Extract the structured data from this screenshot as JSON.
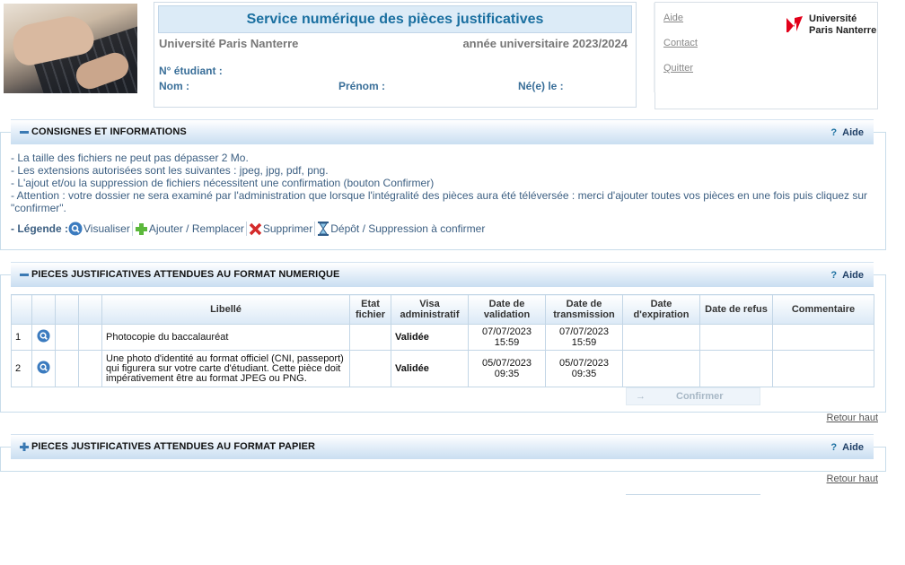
{
  "header": {
    "title": "Service numérique des pièces justificatives",
    "university": "Université Paris Nanterre",
    "year": "année universitaire 2023/2024",
    "student_number_label": "N° étudiant :",
    "last_name_label": "Nom :",
    "first_name_label": "Prénom :",
    "birth_label": "Né(e) le :"
  },
  "links": {
    "aide": "Aide",
    "contact": "Contact",
    "quitter": "Quitter"
  },
  "logo": {
    "line1": "Université",
    "line2": "Paris Nanterre",
    "color": "#e2001a"
  },
  "sections": {
    "consignes": {
      "title": "CONSIGNES ET INFORMATIONS",
      "help": "Aide",
      "lines": [
        "- La taille des fichiers ne peut pas dépasser 2 Mo.",
        "- Les extensions autorisées sont les suivantes : jpeg, jpg, pdf, png.",
        "- L'ajout et/ou la suppression de fichiers nécessitent une confirmation (bouton Confirmer)",
        "- Attention : votre dossier ne sera examiné par l'administration que lorsque l'intégralité des pièces aura été téléversée : merci d'ajouter toutes vos pièces en une fois puis cliquez sur \"confirmer\"."
      ],
      "legend": {
        "label": "- Légende :",
        "view": "Visualiser",
        "add": "Ajouter / Remplacer",
        "delete": "Supprimer",
        "pending": "Dépôt / Suppression à confirmer"
      }
    },
    "numerique": {
      "title": "PIECES JUSTIFICATIVES ATTENDUES AU FORMAT NUMERIQUE",
      "help": "Aide",
      "columns": {
        "libelle": "Libellé",
        "etat": "Etat fichier",
        "visa": "Visa administratif",
        "validation": "Date de validation",
        "transmission": "Date de transmission",
        "expiration": "Date d'expiration",
        "refus": "Date de refus",
        "commentaire": "Commentaire"
      },
      "rows": [
        {
          "num": "1",
          "libelle": "Photocopie du baccalauréat",
          "etat": "",
          "visa": "Validée",
          "validation": "07/07/2023 15:59",
          "transmission": "07/07/2023 15:59",
          "expiration": "",
          "refus": "",
          "commentaire": ""
        },
        {
          "num": "2",
          "libelle": "Une photo d'identité au format officiel (CNI, passeport) qui figurera sur votre carte d'étudiant. Cette pièce doit impérativement être au format JPEG ou PNG.",
          "etat": "",
          "visa": "Validée",
          "validation": "05/07/2023 09:35",
          "transmission": "05/07/2023 09:35",
          "expiration": "",
          "refus": "",
          "commentaire": ""
        }
      ],
      "confirm_label": "Confirmer",
      "back_top": "Retour haut"
    },
    "papier": {
      "title": "PIECES JUSTIFICATIVES ATTENDUES AU FORMAT PAPIER",
      "help": "Aide",
      "back_top": "Retour haut"
    }
  },
  "colors": {
    "accent": "#1a6fa0",
    "valid": "#2e7a22",
    "section_head": "#c9def1"
  }
}
